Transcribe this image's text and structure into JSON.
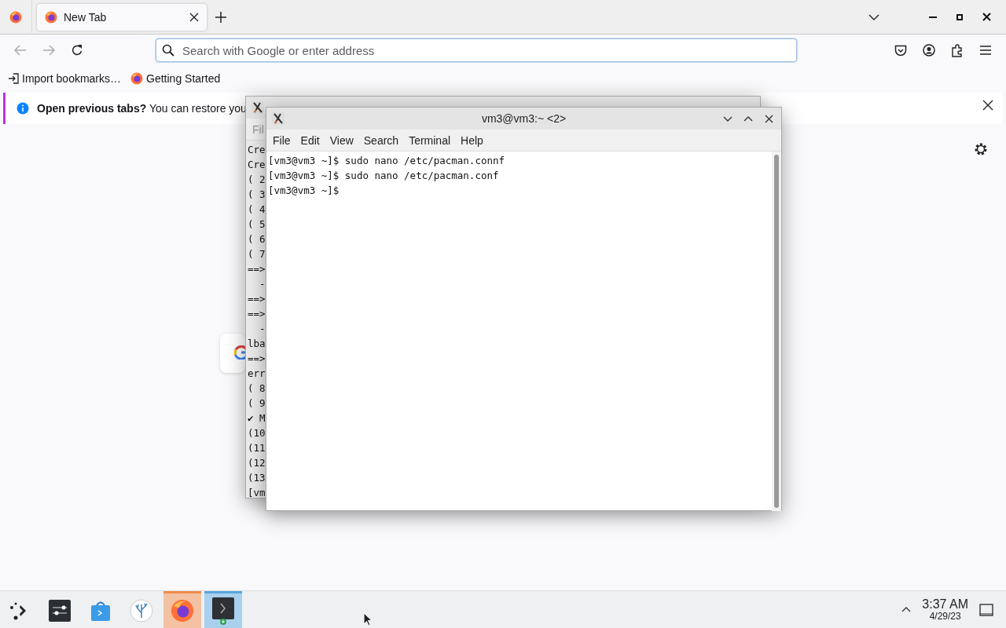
{
  "browser": {
    "tabs": [
      {
        "label": "New Tab",
        "selected": true
      }
    ],
    "address_bar": {
      "placeholder": "Search with Google or enter address"
    },
    "bookmarks": [
      {
        "label": "Import bookmarks…",
        "kind": "import"
      },
      {
        "label": "Getting Started",
        "kind": "firefox"
      }
    ],
    "notification": {
      "text": "**Open previous tabs?** You can restore you"
    }
  },
  "back_terminal": {
    "menu": [
      "Fil"
    ],
    "lines": [
      "Cre",
      "Cre",
      "( 2",
      "( 3",
      "( 4",
      "( 5",
      "( 6",
      "( 7",
      "==>",
      "  -",
      "==>",
      "==>",
      "  -",
      "lba",
      "==>",
      "err",
      "( 8",
      "( 9",
      "✔ M",
      "(10",
      "(11",
      "(12",
      "(13",
      "[vm"
    ]
  },
  "terminal": {
    "title": "vm3@vm3:~ <2>",
    "menu": [
      "File",
      "Edit",
      "View",
      "Search",
      "Terminal",
      "Help"
    ],
    "lines": [
      "[vm3@vm3 ~]$ sudo nano /etc/pacman.connf",
      "[vm3@vm3 ~]$ sudo nano /etc/pacman.conf",
      "[vm3@vm3 ~]$"
    ]
  },
  "taskbar": {
    "apps": [
      {
        "kind": "launcher",
        "attention": false,
        "focused": false
      },
      {
        "kind": "settings",
        "attention": false,
        "focused": false
      },
      {
        "kind": "store",
        "attention": false,
        "focused": false
      },
      {
        "kind": "coral",
        "attention": false,
        "focused": false
      },
      {
        "kind": "firefox",
        "attention": true,
        "focused": false
      },
      {
        "kind": "terminal",
        "attention": false,
        "focused": true
      }
    ],
    "clock": {
      "time": "3:37 AM",
      "date": "4/29/23"
    }
  }
}
